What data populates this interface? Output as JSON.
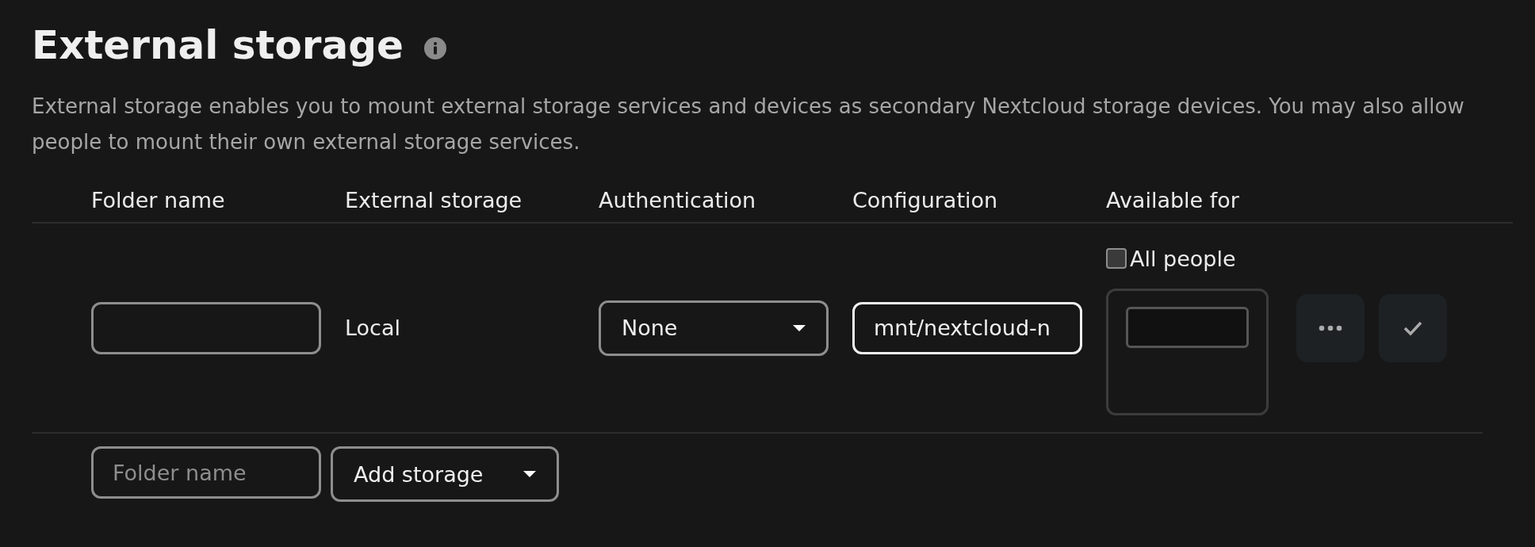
{
  "title": "External storage",
  "description": "External storage enables you to mount external storage services and devices as secondary Nextcloud storage devices. You may also allow people to mount their own external storage services.",
  "table": {
    "columns": [
      "Folder name",
      "External storage",
      "Authentication",
      "Configuration",
      "Available for"
    ],
    "rows": [
      {
        "folder_name": "",
        "storage": "Local",
        "authentication": "None",
        "configuration": "mnt/nextcloud-n",
        "all_people": {
          "label": "All people",
          "checked": false
        }
      }
    ]
  },
  "new_row": {
    "folder_name": {
      "placeholder": "Folder name"
    },
    "storage": "Add storage"
  }
}
